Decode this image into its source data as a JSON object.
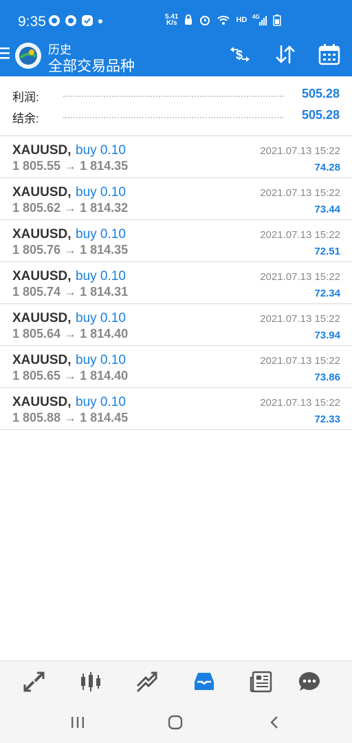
{
  "status_bar": {
    "time": "9:35",
    "speed_top": "5.41",
    "speed_bottom": "K/s",
    "hd": "HD",
    "network": "4G"
  },
  "header": {
    "section": "历史",
    "subtitle": "全部交易品种"
  },
  "summary": {
    "profit_label": "利润:",
    "profit_value": "505.28",
    "balance_label": "结余:",
    "balance_value": "505.28"
  },
  "deals": [
    {
      "symbol": "XAUUSD,",
      "type": "buy 0.10",
      "prices": "1 805.55 → 1 814.35",
      "time": "2021.07.13 15:22",
      "profit": "74.28"
    },
    {
      "symbol": "XAUUSD,",
      "type": "buy 0.10",
      "prices": "1 805.62 → 1 814.32",
      "time": "2021.07.13 15:22",
      "profit": "73.44"
    },
    {
      "symbol": "XAUUSD,",
      "type": "buy 0.10",
      "prices": "1 805.76 → 1 814.35",
      "time": "2021.07.13 15:22",
      "profit": "72.51"
    },
    {
      "symbol": "XAUUSD,",
      "type": "buy 0.10",
      "prices": "1 805.74 → 1 814.31",
      "time": "2021.07.13 15:22",
      "profit": "72.34"
    },
    {
      "symbol": "XAUUSD,",
      "type": "buy 0.10",
      "prices": "1 805.64 → 1 814.40",
      "time": "2021.07.13 15:22",
      "profit": "73.94"
    },
    {
      "symbol": "XAUUSD,",
      "type": "buy 0.10",
      "prices": "1 805.65 → 1 814.40",
      "time": "2021.07.13 15:22",
      "profit": "73.86"
    },
    {
      "symbol": "XAUUSD,",
      "type": "buy 0.10",
      "prices": "1 805.88 → 1 814.45",
      "time": "2021.07.13 15:22",
      "profit": "72.33"
    }
  ],
  "colors": {
    "brand": "#1a7fe0",
    "profit": "#1a7fe0",
    "muted": "#888888"
  },
  "bottom_nav": [
    "quotes-icon",
    "chart-icon",
    "trade-icon",
    "history-icon",
    "news-icon",
    "chat-icon"
  ],
  "active_tab": "history-icon"
}
